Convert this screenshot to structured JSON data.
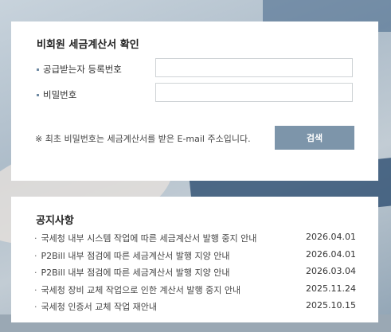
{
  "verify": {
    "title": "비회원 세금계산서 확인",
    "reg_label": "공급받는자 등록번호",
    "reg_value": "",
    "pw_label": "비밀번호",
    "pw_value": "",
    "note": "※ 최초 비밀번호는 세금계산서를 받은 E-mail 주소입니다.",
    "search_label": "검색"
  },
  "notice": {
    "title": "공지사항",
    "items": [
      {
        "title": "국세청 내부 시스템 작업에 따른 세금계산서 발행 중지 안내",
        "date": "2026.04.01"
      },
      {
        "title": "P2Bill 내부 점검에 따른 세금계산서 발행 지양 안내",
        "date": "2026.04.01"
      },
      {
        "title": "P2Bill 내부 점검에 따른 세금계산서 발행 지양 안내",
        "date": "2026.03.04"
      },
      {
        "title": "국세청 장비 교체 작업으로 인한 계산서 발행 중지 안내",
        "date": "2025.11.24"
      },
      {
        "title": "국세청 인증서 교체 작업 재안내",
        "date": "2025.10.15"
      }
    ]
  }
}
